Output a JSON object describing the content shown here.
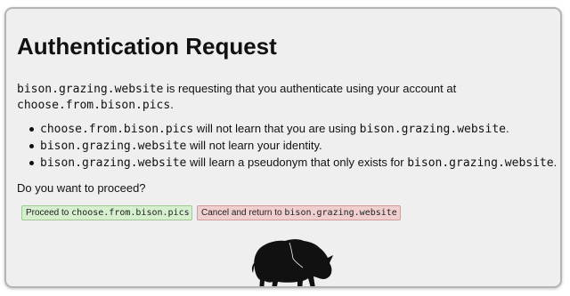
{
  "page": {
    "title": "Authentication Request"
  },
  "intro": {
    "requesting_site": "bison.grazing.website",
    "text_middle": " is requesting that you authenticate using your account at",
    "provider_site": "choose.from.bison.pics",
    "text_end": "."
  },
  "bullets": [
    {
      "site": "choose.from.bison.pics",
      "text_middle": " will not learn that you are using ",
      "site2": "bison.grazing.website",
      "text_end": "."
    },
    {
      "site": "bison.grazing.website",
      "text_middle": " will not learn your identity."
    },
    {
      "site": "bison.grazing.website",
      "text_middle": " will learn a pseudonym that only exists for ",
      "site2": "bison.grazing.website",
      "text_end": "."
    }
  ],
  "question": "Do you want to proceed?",
  "buttons": {
    "proceed": {
      "label": "Proceed to ",
      "site": "choose.from.bison.pics"
    },
    "cancel": {
      "label": "Cancel and return to ",
      "site": "bison.grazing.website"
    }
  },
  "icons": {
    "bison": "bison-silhouette"
  },
  "colors": {
    "panel_bg": "#efefef",
    "proceed_bg": "#d6efcf",
    "cancel_bg": "#f2cfcf"
  }
}
